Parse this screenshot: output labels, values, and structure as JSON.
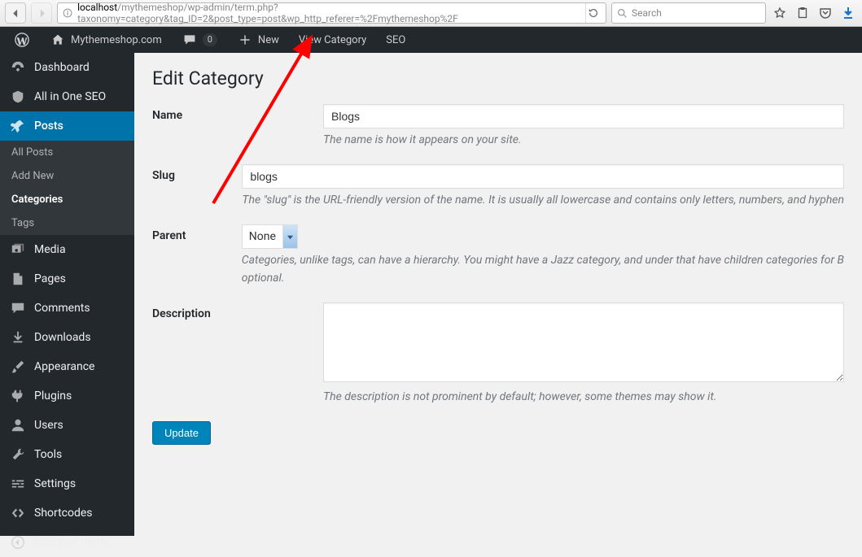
{
  "browser": {
    "url_host": "localhost",
    "url_path": "/mythemeshop/wp-admin/term.php?taxonomy=category&tag_ID=2&post_type=post&wp_http_referer=%2Fmythemeshop%2F",
    "search_placeholder": "Search"
  },
  "adminbar": {
    "site_name": "Mythemeshop.com",
    "comments_count": "0",
    "new_label": "New",
    "view_label": "View Category",
    "seo_label": "SEO"
  },
  "sidebar": {
    "dashboard": "Dashboard",
    "aioseo": "All in One SEO",
    "posts": "Posts",
    "posts_sub": {
      "all": "All Posts",
      "add": "Add New",
      "cats": "Categories",
      "tags": "Tags"
    },
    "media": "Media",
    "pages": "Pages",
    "comments": "Comments",
    "downloads": "Downloads",
    "appearance": "Appearance",
    "plugins": "Plugins",
    "users": "Users",
    "tools": "Tools",
    "settings": "Settings",
    "shortcodes": "Shortcodes",
    "collapse": "Collapse menu"
  },
  "page": {
    "title": "Edit Category",
    "name_label": "Name",
    "name_value": "Blogs",
    "name_help": "The name is how it appears on your site.",
    "slug_label": "Slug",
    "slug_value": "blogs",
    "slug_help": "The \"slug\" is the URL-friendly version of the name. It is usually all lowercase and contains only letters, numbers, and hyphen",
    "parent_label": "Parent",
    "parent_value": "None",
    "parent_help": "Categories, unlike tags, can have a hierarchy. You might have a Jazz category, and under that have children categories for B",
    "parent_help2": "optional.",
    "desc_label": "Description",
    "desc_value": "",
    "desc_help": "The description is not prominent by default; however, some themes may show it.",
    "update_btn": "Update"
  }
}
